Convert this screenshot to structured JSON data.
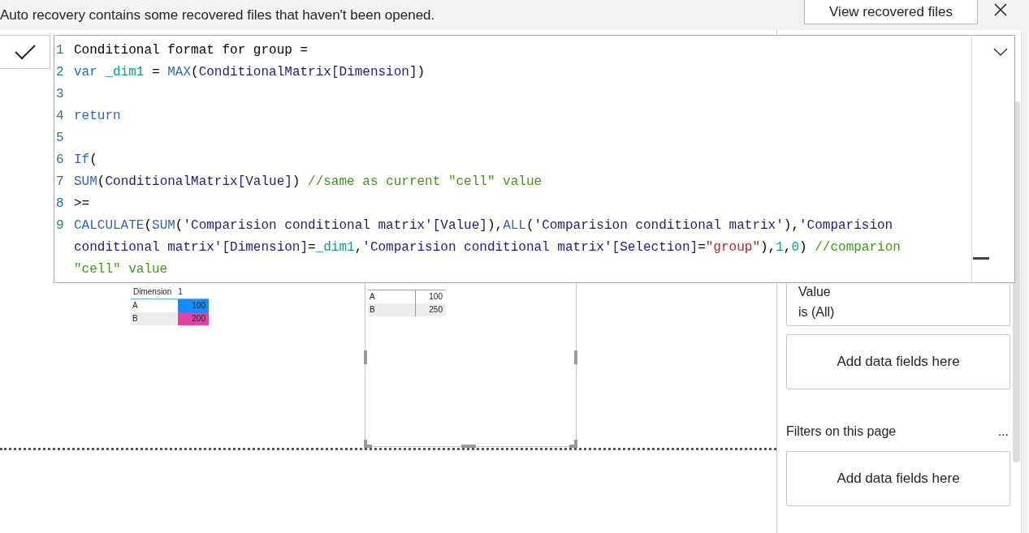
{
  "notification": {
    "message": "Auto recovery contains some recovered files that haven't been opened.",
    "button": "View recovered files"
  },
  "formula": {
    "lines": [
      {
        "number": "1",
        "tokens": [
          {
            "text": "Conditional format for group =",
            "kind": "plain"
          }
        ]
      },
      {
        "number": "2",
        "tokens": [
          {
            "text": "var ",
            "kind": "keyword"
          },
          {
            "text": "_dim1",
            "kind": "variable"
          },
          {
            "text": " = ",
            "kind": "plain"
          },
          {
            "text": "MAX",
            "kind": "keyword"
          },
          {
            "text": "(",
            "kind": "plain"
          },
          {
            "text": "ConditionalMatrix[Dimension]",
            "kind": "reference"
          },
          {
            "text": ")",
            "kind": "plain"
          }
        ]
      },
      {
        "number": "3"
      },
      {
        "number": "4",
        "tokens": [
          {
            "text": "return",
            "kind": "keyword"
          }
        ]
      },
      {
        "number": "5"
      },
      {
        "number": "6",
        "tokens": [
          {
            "text": "If",
            "kind": "keyword"
          },
          {
            "text": "(",
            "kind": "plain"
          }
        ]
      },
      {
        "number": "7",
        "tokens": [
          {
            "text": "SUM",
            "kind": "keyword"
          },
          {
            "text": "(",
            "kind": "plain"
          },
          {
            "text": "ConditionalMatrix[Value]",
            "kind": "reference"
          },
          {
            "text": ") ",
            "kind": "plain"
          },
          {
            "text": "//same as current \"cell\" value",
            "kind": "comment"
          }
        ]
      },
      {
        "number": "8",
        "tokens": [
          {
            "text": ">=",
            "kind": "plain"
          }
        ]
      },
      {
        "number": "9",
        "tokens": [
          {
            "text": "CALCULATE",
            "kind": "keyword"
          },
          {
            "text": "(",
            "kind": "plain"
          },
          {
            "text": "SUM",
            "kind": "keyword"
          },
          {
            "text": "(",
            "kind": "plain"
          },
          {
            "text": "'Comparision conditional matrix'[Value]",
            "kind": "reference"
          },
          {
            "text": "),",
            "kind": "plain"
          },
          {
            "text": "ALL",
            "kind": "keyword"
          },
          {
            "text": "(",
            "kind": "plain"
          },
          {
            "text": "'Comparision conditional matrix'",
            "kind": "reference"
          },
          {
            "text": "),",
            "kind": "plain"
          },
          {
            "text": "'Comparision",
            "kind": "reference"
          }
        ]
      },
      {
        "tokens": [
          {
            "text": "conditional matrix'[Dimension]",
            "kind": "reference"
          },
          {
            "text": "=",
            "kind": "plain"
          },
          {
            "text": "_dim1",
            "kind": "variable"
          },
          {
            "text": ",",
            "kind": "plain"
          },
          {
            "text": "'Comparision conditional matrix'[Selection]",
            "kind": "reference"
          },
          {
            "text": "=",
            "kind": "plain"
          },
          {
            "text": "\"group\"",
            "kind": "string"
          },
          {
            "text": "),",
            "kind": "plain"
          },
          {
            "text": "1",
            "kind": "number"
          },
          {
            "text": ",",
            "kind": "plain"
          },
          {
            "text": "0",
            "kind": "number"
          },
          {
            "text": ") ",
            "kind": "plain"
          },
          {
            "text": "//comparion",
            "kind": "comment"
          }
        ]
      },
      {
        "tokens": [
          {
            "text": "\"cell\" value",
            "kind": "comment"
          }
        ]
      }
    ]
  },
  "visuals": [
    {
      "header": {
        "label": "Dimension",
        "value": "1"
      },
      "rows": [
        {
          "label": "A",
          "value": "100",
          "color": "#118dff"
        },
        {
          "label": "B",
          "value": "200",
          "color": "#e044a7"
        }
      ],
      "selected": false
    },
    {
      "rows": [
        {
          "label": "A",
          "value": "100"
        },
        {
          "label": "B",
          "value": "250"
        }
      ],
      "selected": true
    }
  ],
  "filters_pane": {
    "filter_card": {
      "field": "Value",
      "condition": "is (All)"
    },
    "visual_drop": "Add data fields here",
    "page_heading": "Filters on this page",
    "more": "...",
    "page_drop": "Add data fields here"
  }
}
